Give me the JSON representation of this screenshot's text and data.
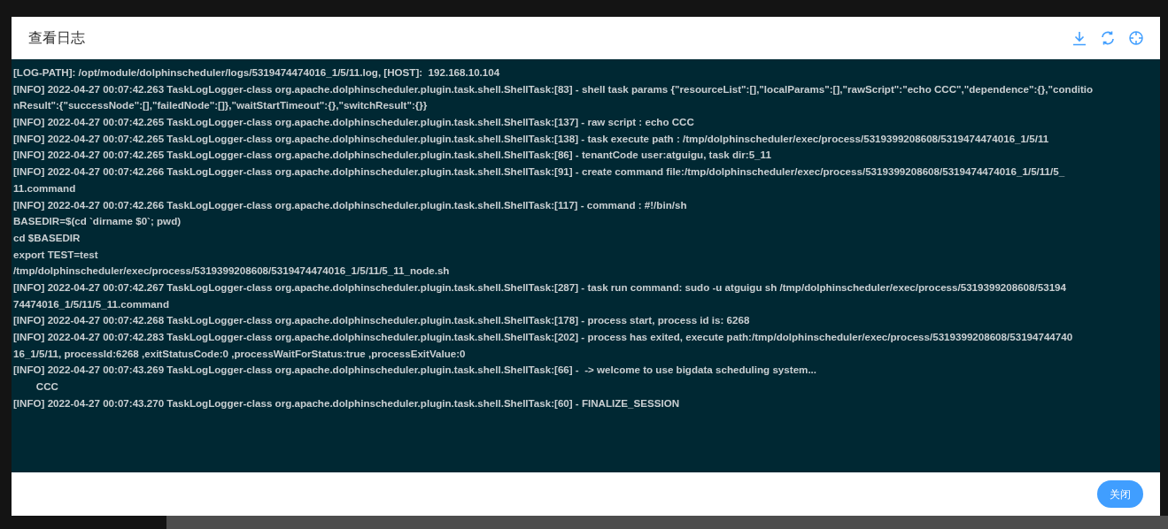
{
  "dialog": {
    "title": "查看日志",
    "close_button": "关闭"
  },
  "log_lines": [
    "[LOG-PATH]: /opt/module/dolphinscheduler/logs/5319474474016_1/5/11.log, [HOST]:  192.168.10.104",
    "[INFO] 2022-04-27 00:07:42.263 TaskLogLogger-class org.apache.dolphinscheduler.plugin.task.shell.ShellTask:[83] - shell task params {\"resourceList\":[],\"localParams\":[],\"rawScript\":\"echo CCC\",\"dependence\":{},\"conditio",
    "nResult\":{\"successNode\":[],\"failedNode\":[]},\"waitStartTimeout\":{},\"switchResult\":{}}",
    "[INFO] 2022-04-27 00:07:42.265 TaskLogLogger-class org.apache.dolphinscheduler.plugin.task.shell.ShellTask:[137] - raw script : echo CCC",
    "[INFO] 2022-04-27 00:07:42.265 TaskLogLogger-class org.apache.dolphinscheduler.plugin.task.shell.ShellTask:[138] - task execute path : /tmp/dolphinscheduler/exec/process/5319399208608/5319474474016_1/5/11",
    "[INFO] 2022-04-27 00:07:42.265 TaskLogLogger-class org.apache.dolphinscheduler.plugin.task.shell.ShellTask:[86] - tenantCode user:atguigu, task dir:5_11",
    "[INFO] 2022-04-27 00:07:42.266 TaskLogLogger-class org.apache.dolphinscheduler.plugin.task.shell.ShellTask:[91] - create command file:/tmp/dolphinscheduler/exec/process/5319399208608/5319474474016_1/5/11/5_",
    "11.command",
    "[INFO] 2022-04-27 00:07:42.266 TaskLogLogger-class org.apache.dolphinscheduler.plugin.task.shell.ShellTask:[117] - command : #!/bin/sh",
    "BASEDIR=$(cd `dirname $0`; pwd)",
    "cd $BASEDIR",
    "export TEST=test",
    "/tmp/dolphinscheduler/exec/process/5319399208608/5319474474016_1/5/11/5_11_node.sh",
    "[INFO] 2022-04-27 00:07:42.267 TaskLogLogger-class org.apache.dolphinscheduler.plugin.task.shell.ShellTask:[287] - task run command: sudo -u atguigu sh /tmp/dolphinscheduler/exec/process/5319399208608/53194",
    "74474016_1/5/11/5_11.command",
    "[INFO] 2022-04-27 00:07:42.268 TaskLogLogger-class org.apache.dolphinscheduler.plugin.task.shell.ShellTask:[178] - process start, process id is: 6268",
    "[INFO] 2022-04-27 00:07:42.283 TaskLogLogger-class org.apache.dolphinscheduler.plugin.task.shell.ShellTask:[202] - process has exited, execute path:/tmp/dolphinscheduler/exec/process/5319399208608/53194744740",
    "16_1/5/11, processId:6268 ,exitStatusCode:0 ,processWaitForStatus:true ,processExitValue:0",
    "[INFO] 2022-04-27 00:07:43.269 TaskLogLogger-class org.apache.dolphinscheduler.plugin.task.shell.ShellTask:[66] -  -> welcome to use bigdata scheduling system...",
    "        CCC",
    "[INFO] 2022-04-27 00:07:43.270 TaskLogLogger-class org.apache.dolphinscheduler.plugin.task.shell.ShellTask:[60] - FINALIZE_SESSION"
  ]
}
